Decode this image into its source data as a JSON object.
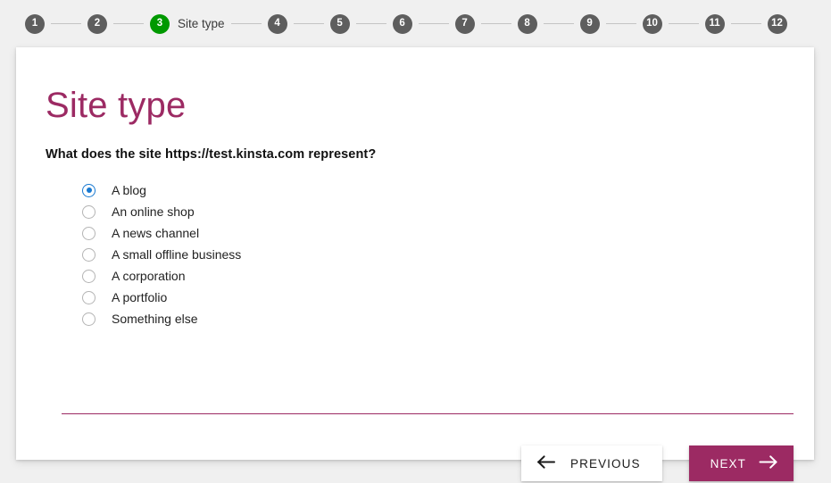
{
  "stepper": {
    "steps": [
      {
        "number": "1",
        "label": "",
        "state": "inactive"
      },
      {
        "number": "2",
        "label": "",
        "state": "inactive"
      },
      {
        "number": "3",
        "label": "Site type",
        "state": "active"
      },
      {
        "number": "4",
        "label": "",
        "state": "inactive"
      },
      {
        "number": "5",
        "label": "",
        "state": "inactive"
      },
      {
        "number": "6",
        "label": "",
        "state": "inactive"
      },
      {
        "number": "7",
        "label": "",
        "state": "inactive"
      },
      {
        "number": "8",
        "label": "",
        "state": "inactive"
      },
      {
        "number": "9",
        "label": "",
        "state": "inactive"
      },
      {
        "number": "10",
        "label": "",
        "state": "inactive"
      },
      {
        "number": "11",
        "label": "",
        "state": "inactive"
      },
      {
        "number": "12",
        "label": "",
        "state": "inactive"
      }
    ],
    "active_step_number": "3",
    "active_step_label": "Site type",
    "total_steps": 12
  },
  "card": {
    "title": "Site type",
    "question": "What does the site https://test.kinsta.com represent?",
    "options": [
      {
        "label": "A blog",
        "selected": true
      },
      {
        "label": "An online shop",
        "selected": false
      },
      {
        "label": "A news channel",
        "selected": false
      },
      {
        "label": "A small offline business",
        "selected": false
      },
      {
        "label": "A corporation",
        "selected": false
      },
      {
        "label": "A portfolio",
        "selected": false
      },
      {
        "label": "Something else",
        "selected": false
      }
    ],
    "footer": {
      "previous_label": "PREVIOUS",
      "previous_icon": "arrow-left-icon",
      "next_label": "NEXT",
      "next_icon": "arrow-right-icon"
    }
  },
  "colors": {
    "page_background": "#f0f0f0",
    "card_background": "#ffffff",
    "brand_magenta": "#9c2a63",
    "step_active_green": "#009900",
    "step_inactive_gray": "#5e5e5e",
    "radio_accent_blue": "#1879d1",
    "divider": "#9c2a63"
  }
}
